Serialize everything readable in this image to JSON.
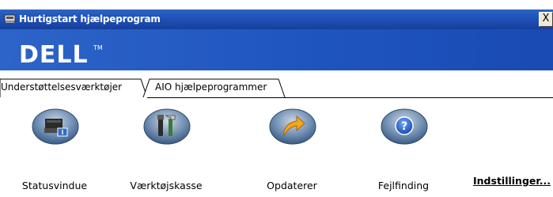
{
  "window": {
    "title": "Hurtigstart hjælpeprogram",
    "close_label": "X"
  },
  "brand": {
    "logo_text": "DELL",
    "trademark": "TM",
    "band_color": "#1f55bf"
  },
  "tabs": [
    {
      "label": "Understøttelsesværktøjer",
      "active": true
    },
    {
      "label": "AIO hjælpeprogrammer",
      "active": false
    }
  ],
  "tools": [
    {
      "label": "Statusvindue",
      "icon": "printer-info-icon"
    },
    {
      "label": "Værktøjskasse",
      "icon": "toolbox-icon"
    },
    {
      "label": "Opdaterer",
      "icon": "update-arrow-icon"
    },
    {
      "label": "Fejlfinding",
      "icon": "question-mark-icon"
    }
  ],
  "settings_link": "Indstillinger..."
}
